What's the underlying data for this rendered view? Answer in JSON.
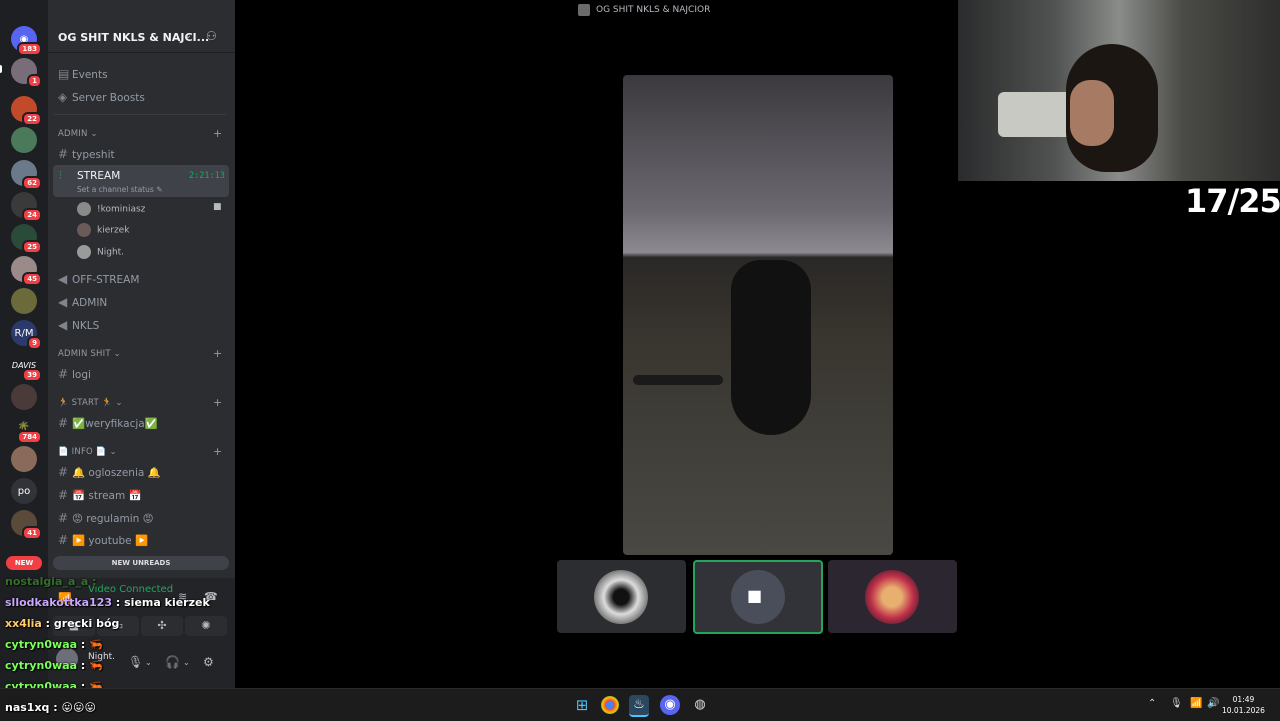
{
  "window": {
    "title": "OG SHIT NKLS & NAJCIOR"
  },
  "rail": {
    "badges": [
      "183",
      "1",
      "22",
      "62",
      "24",
      "25",
      "45",
      "9",
      "39",
      "784",
      "41"
    ],
    "text_icons": {
      "davis": "DAVIS",
      "po": "po",
      "rm": "R/M"
    },
    "new_label": "NEW"
  },
  "sidebar": {
    "guild_name": "OG SHIT NKLS & NAJCI...",
    "top_items": [
      {
        "label": "Events",
        "icon": "calendar-icon"
      },
      {
        "label": "Server Boosts",
        "icon": "boost-icon"
      }
    ],
    "categories": {
      "admin": "ADMIN",
      "admin_shit": "ADMIN SHIT",
      "start": "🏃 START 🏃",
      "info": "📄 INFO 📄"
    },
    "channels": {
      "typeshit": "typeshit",
      "stream": "STREAM",
      "stream_timer": "2:21:13",
      "stream_status": "Set a channel status",
      "off_stream": "OFF-STREAM",
      "admin_vc": "ADMIN",
      "nkls": "NKLS",
      "logi": "logi",
      "weryfikacja": "✅weryfikacja✅",
      "ogloszenia": "🔔 ogloszenia 🔔",
      "stream_txt": "📅 stream 📅",
      "regulamin": "😡 regulamin 😡",
      "youtube": "▶️ youtube ▶️"
    },
    "voice_users": [
      "!kominiasz",
      "kierzek",
      "Night."
    ],
    "new_unreads": "NEW UNREADS"
  },
  "voice_panel": {
    "status": "Video Connected",
    "username": "Night."
  },
  "overlay": {
    "counter": "17/25",
    "chat": [
      {
        "user": "nostalgia_a_a",
        "text": ":"
      },
      {
        "user": "sllodkakottka123",
        "text": ": siema kierzek",
        "color": "#c9a7ff"
      },
      {
        "user": "xx4lia",
        "text": ": grecki bóg",
        "color": "#ffcc66"
      },
      {
        "user": "cytryn0waa",
        "text": ":",
        "color": "#7bff5a"
      },
      {
        "user": "cytryn0waa",
        "text": ":",
        "color": "#7bff5a"
      },
      {
        "user": "cytryn0waa",
        "text": ":",
        "color": "#7bff5a"
      },
      {
        "user": "nas1xq",
        "text": ": 😛😛😛",
        "color": "#ffffff"
      }
    ]
  },
  "taskbar": {
    "time": "01:49",
    "date": "10.01.2026"
  },
  "colors": {
    "green": "#23a55a",
    "red": "#f23f43",
    "sidebar": "#2b2d31",
    "rail": "#1e1f22"
  }
}
